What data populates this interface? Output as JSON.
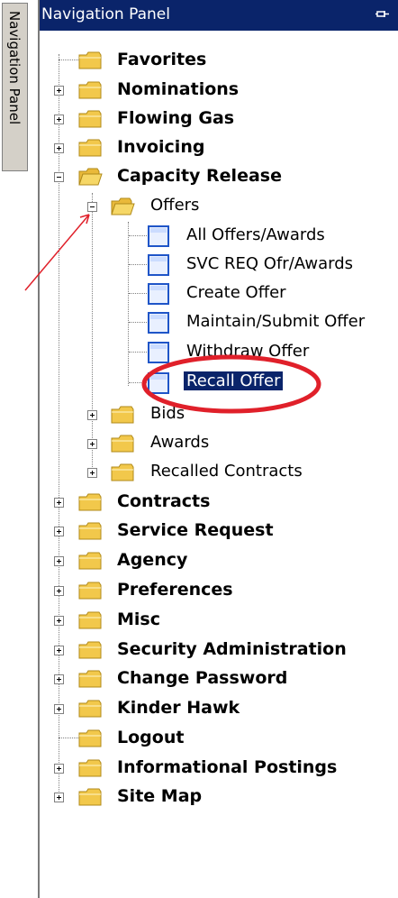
{
  "side_tab": {
    "label": "Navigation Panel"
  },
  "panel": {
    "title": "Navigation Panel"
  },
  "tree": {
    "favorites": "Favorites",
    "nominations": "Nominations",
    "flowing_gas": "Flowing Gas",
    "invoicing": "Invoicing",
    "capacity_release": "Capacity Release",
    "offers": "Offers",
    "all_offers_awards": "All Offers/Awards",
    "svc_req_ofr_awards": "SVC REQ Ofr/Awards",
    "create_offer": "Create Offer",
    "maintain_submit_offer": "Maintain/Submit Offer",
    "withdraw_offer": "Withdraw Offer",
    "recall_offer": "Recall Offer",
    "bids": "Bids",
    "awards": "Awards",
    "recalled_contracts": "Recalled Contracts",
    "contracts": "Contracts",
    "service_request": "Service Request",
    "agency": "Agency",
    "preferences": "Preferences",
    "misc": "Misc",
    "security_administration": "Security Administration",
    "change_password": "Change Password",
    "kinder_hawk": "Kinder Hawk",
    "logout": "Logout",
    "informational_postings": "Informational Postings",
    "site_map": "Site Map"
  },
  "colors": {
    "titlebar": "#0a246a",
    "selection": "#0a246a",
    "annotation": "#e0202a",
    "folder": "#f2c84b"
  }
}
